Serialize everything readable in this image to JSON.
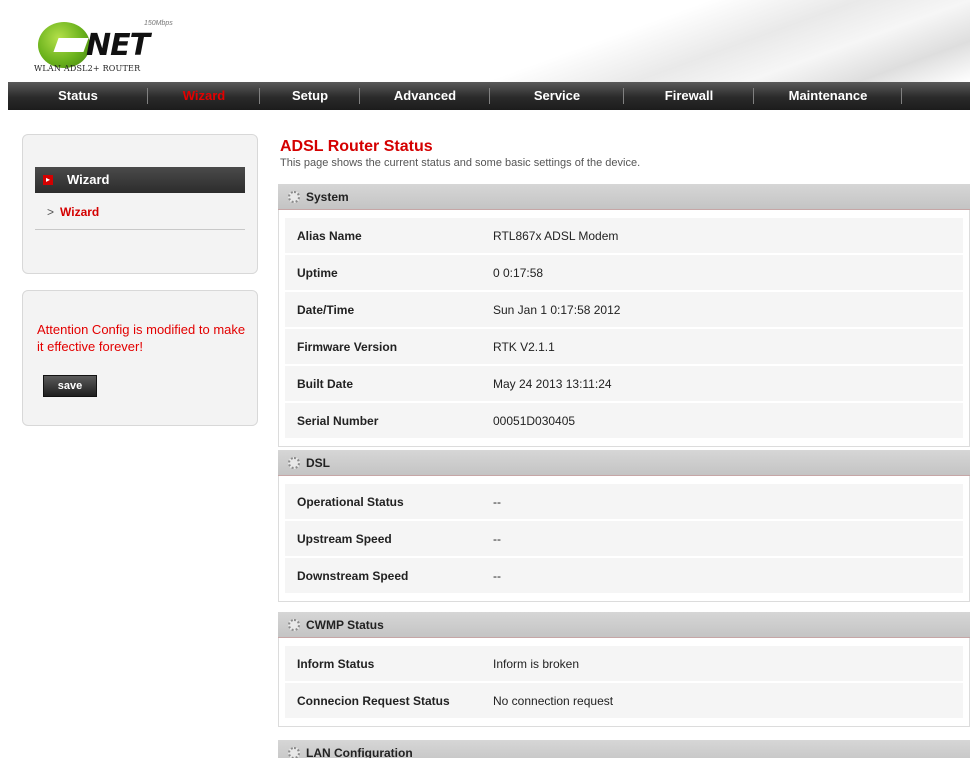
{
  "brand": {
    "logo_text": "NET",
    "speed_text": "150Mbps",
    "subtitle": "WLAN ADSL2+ ROUTER"
  },
  "nav": {
    "items": [
      {
        "label": "Status"
      },
      {
        "label": "Wizard",
        "active": true
      },
      {
        "label": "Setup"
      },
      {
        "label": "Advanced"
      },
      {
        "label": "Service"
      },
      {
        "label": "Firewall"
      },
      {
        "label": "Maintenance"
      }
    ]
  },
  "sidebar": {
    "header": "Wizard",
    "link": "Wizard",
    "link_prefix": ">",
    "attention": "Attention Config is modified to make it effective forever!",
    "save_label": "save"
  },
  "main": {
    "title": "ADSL Router Status",
    "description": "This page shows the current status and some basic settings of the device."
  },
  "sections": {
    "system": {
      "title": "System",
      "rows": [
        {
          "label": "Alias Name",
          "value": "RTL867x ADSL Modem"
        },
        {
          "label": "Uptime",
          "value": "0 0:17:58"
        },
        {
          "label": "Date/Time",
          "value": "Sun Jan 1 0:17:58 2012"
        },
        {
          "label": "Firmware Version",
          "value": "RTK V2.1.1"
        },
        {
          "label": "Built Date",
          "value": "May 24 2013 13:11:24"
        },
        {
          "label": "Serial Number",
          "value": "00051D030405"
        }
      ]
    },
    "dsl": {
      "title": "DSL",
      "rows": [
        {
          "label": "Operational Status",
          "value": "--"
        },
        {
          "label": "Upstream Speed",
          "value": "--"
        },
        {
          "label": "Downstream Speed",
          "value": "--"
        }
      ]
    },
    "cwmp": {
      "title": "CWMP Status",
      "rows": [
        {
          "label": "Inform Status",
          "value": "Inform is broken"
        },
        {
          "label": "Connecion Request Status",
          "value": "No connection request"
        }
      ]
    },
    "lan": {
      "title": "LAN Configuration"
    }
  },
  "colors": {
    "accent_red": "#d40000",
    "nav_dark": "#2a2a2a"
  }
}
